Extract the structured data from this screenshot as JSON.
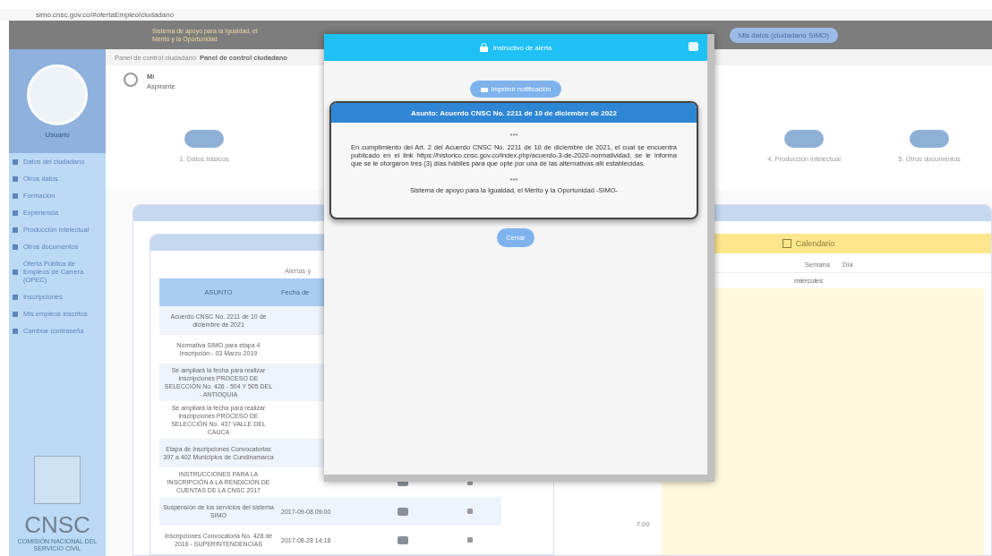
{
  "browser": {
    "url": "simo.cnsc.gov.co/#ofertaEmpleo/ciudadano"
  },
  "header": {
    "logo_text": "Sistema de apoyo para la Igualdad, el Mérito y la Oportunidad",
    "user_button": "Mis datos (ciudadano SIMO)"
  },
  "sidebar": {
    "user_name": "Usuario",
    "items": [
      {
        "label": "Datos del ciudadano"
      },
      {
        "label": "Otros datos"
      },
      {
        "label": "Formación"
      },
      {
        "label": "Experiencia"
      },
      {
        "label": "Producción intelectual"
      },
      {
        "label": "Otros documentos"
      },
      {
        "label": "Oferta Pública de Empleos de Carrera (OPEC)"
      },
      {
        "label": "Inscripciones"
      },
      {
        "label": "Mis empleos inscritos"
      },
      {
        "label": "Cambiar contraseña"
      }
    ],
    "logo_text": "CNSC",
    "logo_subtitle": "COMISIÓN NACIONAL DEL SERVICIO CIVIL"
  },
  "breadcrumb": {
    "parent": "Panel de control ciudadano",
    "current": "Panel de control ciudadano"
  },
  "profile": {
    "name": "Mi",
    "role": "Aspirante"
  },
  "steps": [
    {
      "label": "1. Datos básicos"
    },
    {
      "label": "4. Producción intelectual"
    },
    {
      "label": "5. Otros documentos"
    }
  ],
  "alerts": {
    "caption": "Alertas y",
    "columns": [
      "ASUNTO",
      "Fecha de"
    ],
    "rows": [
      {
        "subject": "Acuerdo CNSC No. 2211 de 10 de diciembre de 2021"
      },
      {
        "subject": "Normativa SIMO para etapa 4 Inscripción - 03 Marzo 2019"
      },
      {
        "subject": "Se ampliará la fecha para realizar inscripciones PROCESO DE SELECCIÓN No. 426 - 504 Y 505 DEL - ANTIOQUIA"
      },
      {
        "subject": "Se ampliará la fecha para realizar inscripciones PROCESO DE SELECCIÓN No. 437 VALLE DEL CAUCA"
      },
      {
        "subject": "Etapa de Inscripciones Convocatorias 397 a 402 Municipios de Cundinamarca"
      },
      {
        "subject": "INSTRUCCIONES PARA LA INSCRIPCIÓN A LA RENDICIÓN DE CUENTAS DE LA CNSC 2017"
      },
      {
        "subject": "Suspensión de los servicios del sistema SIMO",
        "date": "2017-09-08 09:00"
      },
      {
        "subject": "Inscripciones Convocatoria No. 428 de 2016 - SUPERINTENDENCIAS",
        "date": "2017-08-28 14:18"
      }
    ]
  },
  "calendar": {
    "title": "Calendario",
    "toolbar": [
      "Semana",
      "Día"
    ],
    "column": "miércoles",
    "hour": "7:00"
  },
  "modal": {
    "title": "Instructivo de alerta",
    "print_button": "Imprimir notificación",
    "notice": {
      "subject": "Asunto: Acuerdo CNSC No. 2211 de 10 de diciembre de 2022",
      "separator_top": "***",
      "message": "En cumplimiento del Art. 2 del Acuerdo CNSC No. 2211 de 10 de diciembre de 2021, el cual se encuentra publicado en el link https://historico.cnsc.gov.co/index.php/acuerdo-3-de-2020-normatividad, se le informa que se le otorgaron tres (3) días hábiles para que opte por una de las alternativas allí establecidas.",
      "separator_bottom": "***",
      "signature": "Sistema de apoyo para la Igualdad, el Mérito y la Oportunidad -SIMO-"
    },
    "close_button": "Cerrar"
  }
}
